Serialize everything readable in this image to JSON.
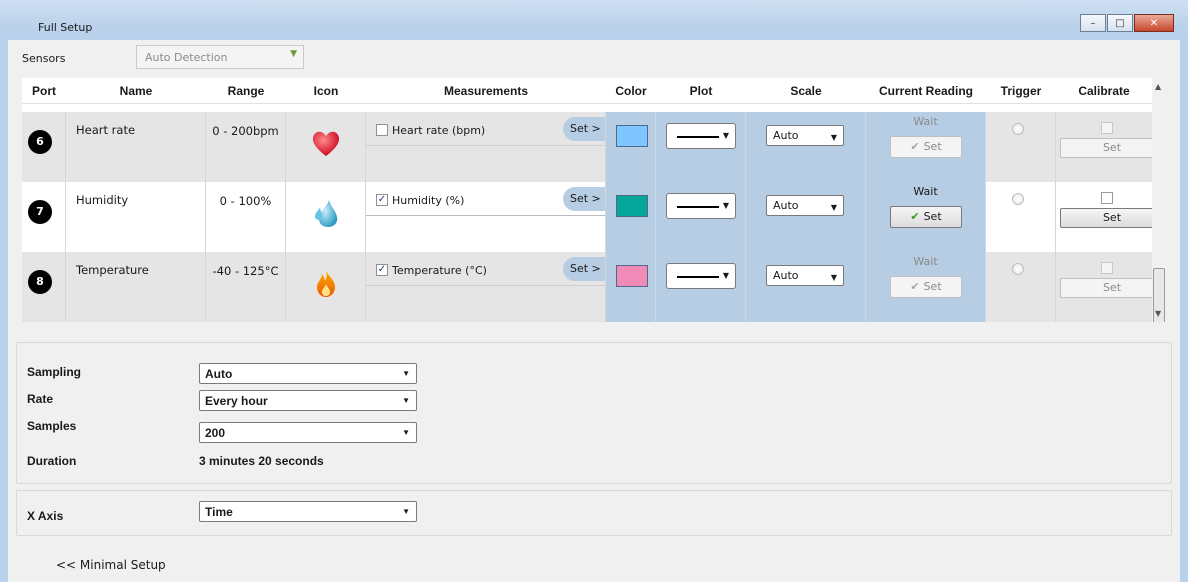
{
  "window": {
    "title": "Full Setup",
    "buttons": [
      "minimize",
      "maximize",
      "close"
    ]
  },
  "sensors": {
    "label": "Sensors",
    "detection": "Auto Detection"
  },
  "table": {
    "headers": [
      "Port",
      "Name",
      "Range",
      "Icon",
      "Measurements",
      "Color",
      "Plot",
      "Scale",
      "Current Reading",
      "Trigger",
      "Calibrate"
    ],
    "rows": [
      {
        "port": "6",
        "name": "Heart rate",
        "range": "0 - 200bpm",
        "icon": "heart-icon",
        "measurement": "Heart rate (bpm)",
        "measurement_checked": false,
        "set_label": "Set >",
        "color": "#7fc5ff",
        "scale": "Auto",
        "reading": "Wait",
        "reading_button": "Set",
        "enabled": false,
        "calibrate_button": "Set"
      },
      {
        "port": "7",
        "name": "Humidity",
        "range": "0 - 100%",
        "icon": "water-drop-icon",
        "measurement": "Humidity (%)",
        "measurement_checked": true,
        "set_label": "Set >",
        "color": "#06a59a",
        "scale": "Auto",
        "reading": "Wait",
        "reading_button": "Set",
        "enabled": true,
        "calibrate_button": "Set"
      },
      {
        "port": "8",
        "name": "Temperature",
        "range": "-40 - 125°C",
        "icon": "flame-icon",
        "measurement": "Temperature (°C)",
        "measurement_checked": true,
        "set_label": "Set >",
        "color": "#f08bb8",
        "scale": "Auto",
        "reading": "Wait",
        "reading_button": "Set",
        "enabled": false,
        "calibrate_button": "Set"
      }
    ]
  },
  "sampling": {
    "sampling_label": "Sampling",
    "sampling_value": "Auto",
    "rate_label": "Rate",
    "rate_value": "Every hour",
    "samples_label": "Samples",
    "samples_value": "200",
    "duration_label": "Duration",
    "duration_value": "3 minutes 20 seconds"
  },
  "xaxis": {
    "label": "X Axis",
    "value": "Time"
  },
  "footer": {
    "minimal_link": "<< Minimal Setup"
  }
}
